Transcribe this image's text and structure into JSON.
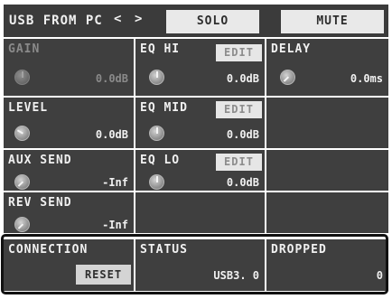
{
  "header": {
    "title": "USB FROM PC",
    "prev_symbol": "<",
    "next_symbol": ">",
    "solo_label": "SOLO",
    "mute_label": "MUTE"
  },
  "params": {
    "gain": {
      "label": "GAIN",
      "value": "0.0dB",
      "state": "disabled"
    },
    "level": {
      "label": "LEVEL",
      "value": "0.0dB"
    },
    "aux_send": {
      "label": "AUX SEND",
      "value": "-Inf"
    },
    "rev_send": {
      "label": "REV SEND",
      "value": "-Inf"
    },
    "eq_hi": {
      "label": "EQ HI",
      "value": "0.0dB",
      "edit_label": "EDIT"
    },
    "eq_mid": {
      "label": "EQ MID",
      "value": "0.0dB",
      "edit_label": "EDIT"
    },
    "eq_lo": {
      "label": "EQ LO",
      "value": "0.0dB",
      "edit_label": "EDIT"
    },
    "delay": {
      "label": "DELAY",
      "value": "0.0ms"
    }
  },
  "connection": {
    "label": "CONNECTION",
    "reset_label": "RESET",
    "status_label": "STATUS",
    "status_value": "USB3. 0",
    "dropped_label": "DROPPED",
    "dropped_value": "0"
  },
  "colors": {
    "panel": "#3f3f3f",
    "header": "#3b3b3b",
    "text": "#f0f0f0",
    "dim_text": "#8a8a8a",
    "button": "#e6e6e6"
  },
  "icons": {
    "knob": "rotary-knob"
  }
}
